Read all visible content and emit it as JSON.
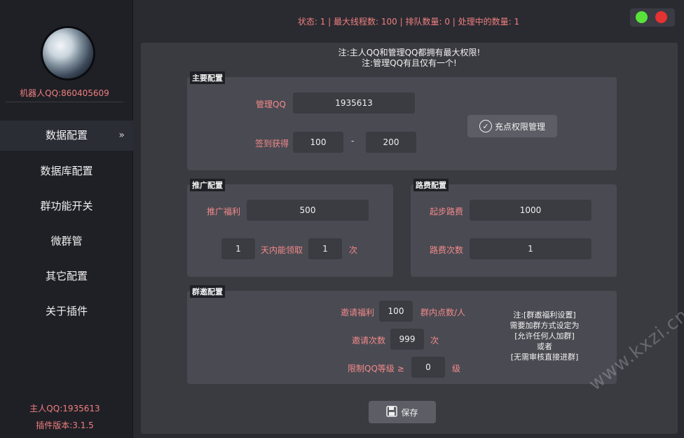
{
  "sidebar": {
    "robot_qq": "机器人QQ:860405609",
    "items": [
      {
        "label": "数据配置",
        "active": true
      },
      {
        "label": "数据库配置"
      },
      {
        "label": "群功能开关"
      },
      {
        "label": "微群管"
      },
      {
        "label": "其它配置"
      },
      {
        "label": "关于插件"
      }
    ],
    "owner_qq": "主人QQ:1935613",
    "plugin_version": "插件版本:3.1.5"
  },
  "status": {
    "text": "状态: 1 | 最大线程数: 100 | 排队数量: 0 | 处理中的数量: 1"
  },
  "notes": {
    "line1": "注:主人QQ和管理QQ都拥有最大权限!",
    "line2": "注:管理QQ有且仅有一个!"
  },
  "main_config": {
    "title": "主要配置",
    "admin_qq_label": "管理QQ",
    "admin_qq_value": "1935613",
    "signin_label": "签到获得",
    "signin_min": "100",
    "signin_sep": "-",
    "signin_max": "200",
    "perm_button": "充点权限管理"
  },
  "promo_config": {
    "title": "推广配置",
    "reward_label": "推广福利",
    "reward_value": "500",
    "days_value": "1",
    "days_label": "天内能领取",
    "times_value": "1",
    "times_label": "次"
  },
  "toll_config": {
    "title": "路费配置",
    "start_label": "起步路费",
    "start_value": "1000",
    "count_label": "路费次数",
    "count_value": "1"
  },
  "invite_config": {
    "title": "群邀配置",
    "reward_label": "邀请福利",
    "reward_value": "100",
    "reward_unit": "群内点数/人",
    "count_label": "邀请次数",
    "count_value": "999",
    "count_unit": "次",
    "level_label": "限制QQ等级 ≥",
    "level_value": "0",
    "level_unit": "级",
    "note_lines": [
      "注:[群邀福利设置]",
      "需要加群方式设定为",
      "[允许任何人加群]",
      "或者",
      "[无需审核直接进群]"
    ]
  },
  "save_button": "保存",
  "watermark": "www.kxzi.cn",
  "colors": {
    "label_red": "#f28a8a",
    "status_red": "#f07f7f",
    "green_dot": "#58e23a",
    "red_dot": "#e53232"
  }
}
